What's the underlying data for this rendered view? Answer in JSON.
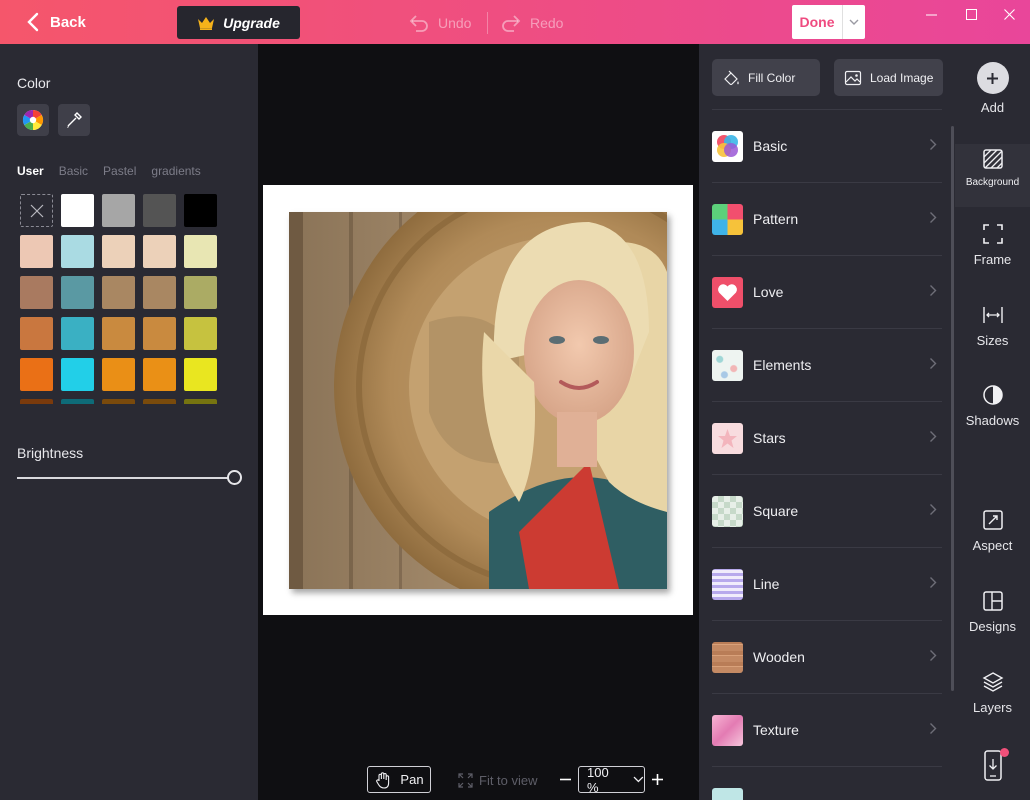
{
  "topbar": {
    "back_label": "Back",
    "upgrade_label": "Upgrade",
    "undo_label": "Undo",
    "redo_label": "Redo",
    "done_label": "Done"
  },
  "left_panel": {
    "color_title": "Color",
    "tabs": [
      "User",
      "Basic",
      "Pastel",
      "gradients"
    ],
    "active_tab": "User",
    "swatches": [
      "none",
      "#ffffff",
      "#a6a6a6",
      "#545454",
      "#000000",
      "#edc8b4",
      "#aadbe3",
      "#ecd1b9",
      "#ecd1b9",
      "#e8e6b3",
      "#a97a60",
      "#5a99a3",
      "#a98762",
      "#a98762",
      "#abab64",
      "#c9773f",
      "#3ab0c3",
      "#c98a3f",
      "#c98a3f",
      "#c6c23f",
      "#ea7016",
      "#22cfe8",
      "#ea8f16",
      "#ea9016",
      "#e9e620",
      "#7a3a0c",
      "#0e6b78",
      "#7a4a0c",
      "#7a4b0c",
      "#767410"
    ],
    "brightness_title": "Brightness",
    "brightness_value": 1.0
  },
  "canvas": {
    "pan_label": "Pan",
    "fit_label": "Fit to view",
    "zoom_value": "100 %"
  },
  "bg_panel": {
    "fill_color_label": "Fill Color",
    "load_image_label": "Load Image",
    "categories": [
      {
        "label": "Basic"
      },
      {
        "label": "Pattern"
      },
      {
        "label": "Love"
      },
      {
        "label": "Elements"
      },
      {
        "label": "Stars"
      },
      {
        "label": "Square"
      },
      {
        "label": "Line"
      },
      {
        "label": "Wooden"
      },
      {
        "label": "Texture"
      }
    ]
  },
  "rail": {
    "items": [
      {
        "label": "Add",
        "icon": "plus-icon"
      },
      {
        "label": "Background",
        "icon": "background-icon"
      },
      {
        "label": "Frame",
        "icon": "frame-icon"
      },
      {
        "label": "Sizes",
        "icon": "sizes-icon"
      },
      {
        "label": "Shadows",
        "icon": "shadows-icon"
      },
      {
        "label": "Aspect",
        "icon": "aspect-icon"
      },
      {
        "label": "Designs",
        "icon": "designs-icon"
      },
      {
        "label": "Layers",
        "icon": "layers-icon"
      }
    ],
    "active": "Background"
  }
}
